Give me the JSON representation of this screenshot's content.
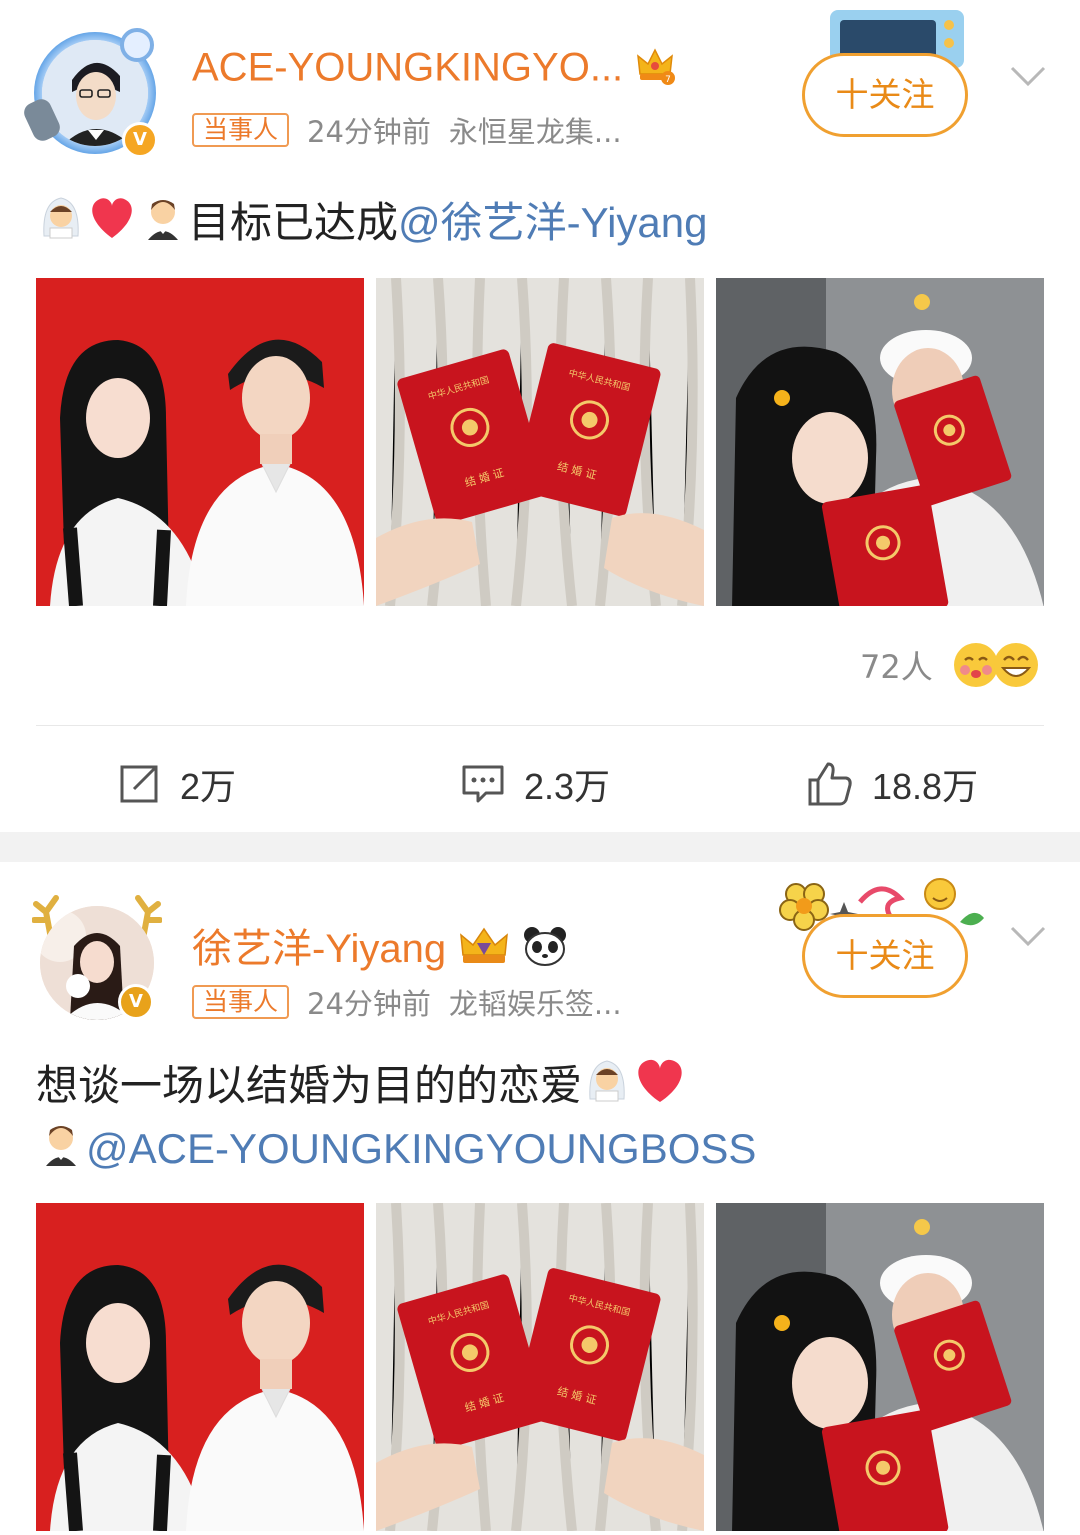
{
  "colors": {
    "accent": "#ec7a2b",
    "follow": "#e98a17",
    "link": "#4f7cb5",
    "meta": "#8a8a8a"
  },
  "posts": [
    {
      "username": "ACE-YOUNGKINGYO...",
      "tag": "当事人",
      "time": "24分钟前",
      "source": "永恒星龙集...",
      "follow_label": "十关注",
      "text": "目标已达成",
      "mention": "@徐艺洋-Yiyang",
      "likes_people": "72人",
      "actions": {
        "repost": "2万",
        "comment": "2.3万",
        "like": "18.8万"
      }
    },
    {
      "username": "徐艺洋-Yiyang",
      "tag": "当事人",
      "time": "24分钟前",
      "source": "龙韬娱乐签...",
      "follow_label": "十关注",
      "text": "想谈一场以结婚为目的的恋爱",
      "mention": "@ACE-YOUNGKINGYOUNGBOSS"
    }
  ],
  "photo_labels": {
    "certificate_title": "中华人民共和国",
    "certificate_name": "结 婚 证"
  }
}
